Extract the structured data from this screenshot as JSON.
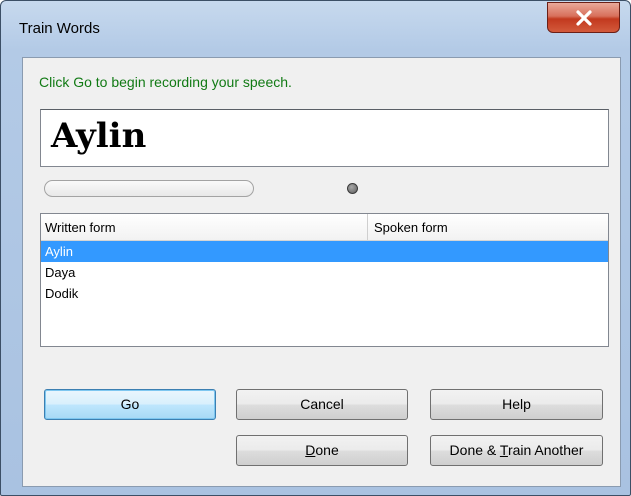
{
  "window": {
    "title": "Train Words",
    "close_glyph": "X"
  },
  "instruction": "Click Go to begin recording your speech.",
  "current_word": "Aylin",
  "meter": {
    "level": 0
  },
  "list": {
    "columns": [
      "Written form",
      "Spoken form"
    ],
    "rows": [
      {
        "written": "Aylin",
        "spoken": "",
        "selected": true
      },
      {
        "written": "Daya",
        "spoken": "",
        "selected": false
      },
      {
        "written": "Dodik",
        "spoken": "",
        "selected": false
      }
    ]
  },
  "buttons": {
    "go": "Go",
    "cancel": "Cancel",
    "help": "Help",
    "done_pre": "",
    "done_key": "D",
    "done_post": "one",
    "train_pre": "Done & ",
    "train_key": "T",
    "train_post": "rain Another"
  },
  "colors": {
    "instruction": "#117a14",
    "selection": "#3399ff",
    "close_button": "#c2391f"
  }
}
